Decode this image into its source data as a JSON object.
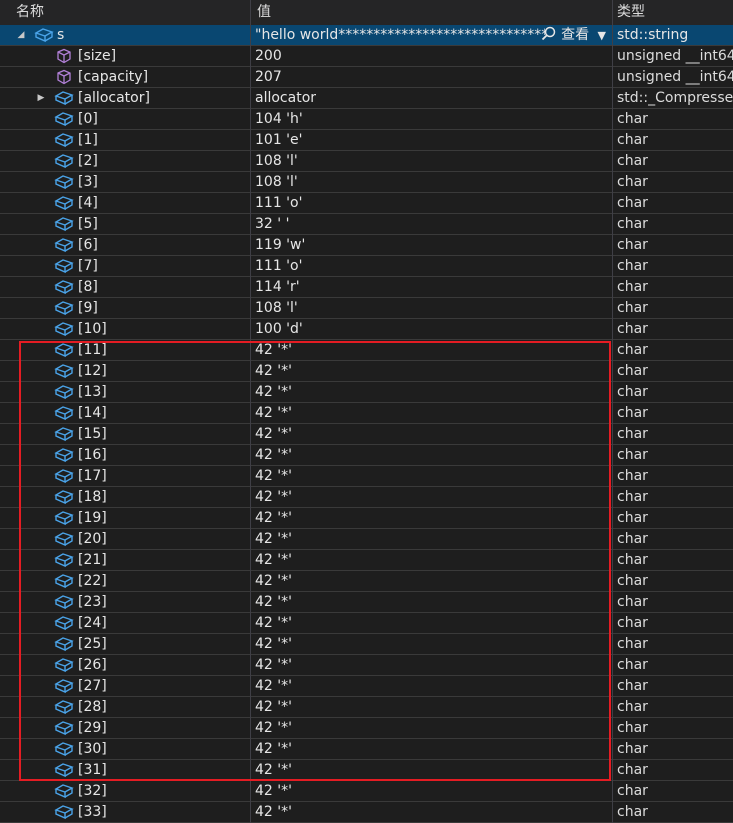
{
  "columns": {
    "name": "名称",
    "value": "值",
    "type": "类型"
  },
  "root": {
    "name": "s",
    "value": "\"hello world*********************************...",
    "view_label": "查看",
    "type": "std::string"
  },
  "members": [
    {
      "name": "[size]",
      "value": "200",
      "type": "unsigned __int64",
      "icon": "field-icon"
    },
    {
      "name": "[capacity]",
      "value": "207",
      "type": "unsigned __int64",
      "icon": "field-icon"
    },
    {
      "name": "[allocator]",
      "value": "allocator",
      "type": "std::_Compresse...",
      "icon": "object-icon",
      "expandable": true
    }
  ],
  "elements": [
    {
      "name": "[0]",
      "value": "104 'h'",
      "type": "char"
    },
    {
      "name": "[1]",
      "value": "101 'e'",
      "type": "char"
    },
    {
      "name": "[2]",
      "value": "108 'l'",
      "type": "char"
    },
    {
      "name": "[3]",
      "value": "108 'l'",
      "type": "char"
    },
    {
      "name": "[4]",
      "value": "111 'o'",
      "type": "char"
    },
    {
      "name": "[5]",
      "value": "32 ' '",
      "type": "char"
    },
    {
      "name": "[6]",
      "value": "119 'w'",
      "type": "char"
    },
    {
      "name": "[7]",
      "value": "111 'o'",
      "type": "char"
    },
    {
      "name": "[8]",
      "value": "114 'r'",
      "type": "char"
    },
    {
      "name": "[9]",
      "value": "108 'l'",
      "type": "char"
    },
    {
      "name": "[10]",
      "value": "100 'd'",
      "type": "char"
    },
    {
      "name": "[11]",
      "value": "42 '*'",
      "type": "char"
    },
    {
      "name": "[12]",
      "value": "42 '*'",
      "type": "char"
    },
    {
      "name": "[13]",
      "value": "42 '*'",
      "type": "char"
    },
    {
      "name": "[14]",
      "value": "42 '*'",
      "type": "char"
    },
    {
      "name": "[15]",
      "value": "42 '*'",
      "type": "char"
    },
    {
      "name": "[16]",
      "value": "42 '*'",
      "type": "char"
    },
    {
      "name": "[17]",
      "value": "42 '*'",
      "type": "char"
    },
    {
      "name": "[18]",
      "value": "42 '*'",
      "type": "char"
    },
    {
      "name": "[19]",
      "value": "42 '*'",
      "type": "char"
    },
    {
      "name": "[20]",
      "value": "42 '*'",
      "type": "char"
    },
    {
      "name": "[21]",
      "value": "42 '*'",
      "type": "char"
    },
    {
      "name": "[22]",
      "value": "42 '*'",
      "type": "char"
    },
    {
      "name": "[23]",
      "value": "42 '*'",
      "type": "char"
    },
    {
      "name": "[24]",
      "value": "42 '*'",
      "type": "char"
    },
    {
      "name": "[25]",
      "value": "42 '*'",
      "type": "char"
    },
    {
      "name": "[26]",
      "value": "42 '*'",
      "type": "char"
    },
    {
      "name": "[27]",
      "value": "42 '*'",
      "type": "char"
    },
    {
      "name": "[28]",
      "value": "42 '*'",
      "type": "char"
    },
    {
      "name": "[29]",
      "value": "42 '*'",
      "type": "char"
    },
    {
      "name": "[30]",
      "value": "42 '*'",
      "type": "char"
    },
    {
      "name": "[31]",
      "value": "42 '*'",
      "type": "char"
    },
    {
      "name": "[32]",
      "value": "42 '*'",
      "type": "char"
    },
    {
      "name": "[33]",
      "value": "42 '*'",
      "type": "char"
    }
  ],
  "colors": {
    "highlight": "#e51c23",
    "selection": "#094771",
    "icon_blue": "#4aa3e8",
    "icon_purple": "#b180d7"
  }
}
